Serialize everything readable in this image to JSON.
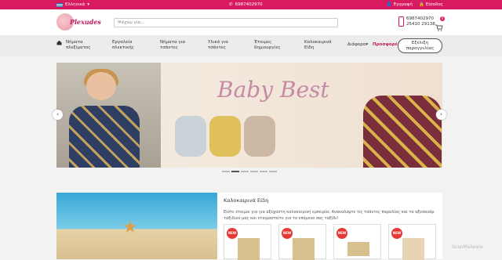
{
  "topbar": {
    "language": "Ελληνικά",
    "phone": "6987402970",
    "register": "Εγγραφή",
    "login": "Είσοδος"
  },
  "header": {
    "logo_text": "Plexudes",
    "search_placeholder": "Ψάχνω για...",
    "phone1": "6987402970",
    "phone2": "25410 29138",
    "cart_count": "0"
  },
  "nav": {
    "items": [
      "Νήματα πλεξίματος",
      "Εργαλεία πλεκτικής",
      "Νήματα για τσάντες",
      "Υλικά για τσάντες",
      "Έτοιμες δημιουργίες",
      "Καλοκαιρινά Είδη",
      "Διάφορα",
      "Προσφορές"
    ],
    "order_button": "Εξέλιξη παραγγελίας"
  },
  "slider": {
    "headline": "Baby Best",
    "prev": "‹",
    "next": "›",
    "slide_count": 6,
    "active_index": 1
  },
  "section": {
    "title": "Καλοκαιρινά Είδη",
    "description": "Είστε έτοιμοι για για αξέχαστη καλοκαιρινή εμπειρία; Ανακαλύψτε τις τσάντες παραλίας και τα αξεσουάρ ταξιδιού μας και ετοιμαστείτε για το επόμενο σας ταξίδι!",
    "badge": "NEW"
  },
  "watermark": "ScanMalware",
  "colors": {
    "brand": "#d81b60"
  }
}
